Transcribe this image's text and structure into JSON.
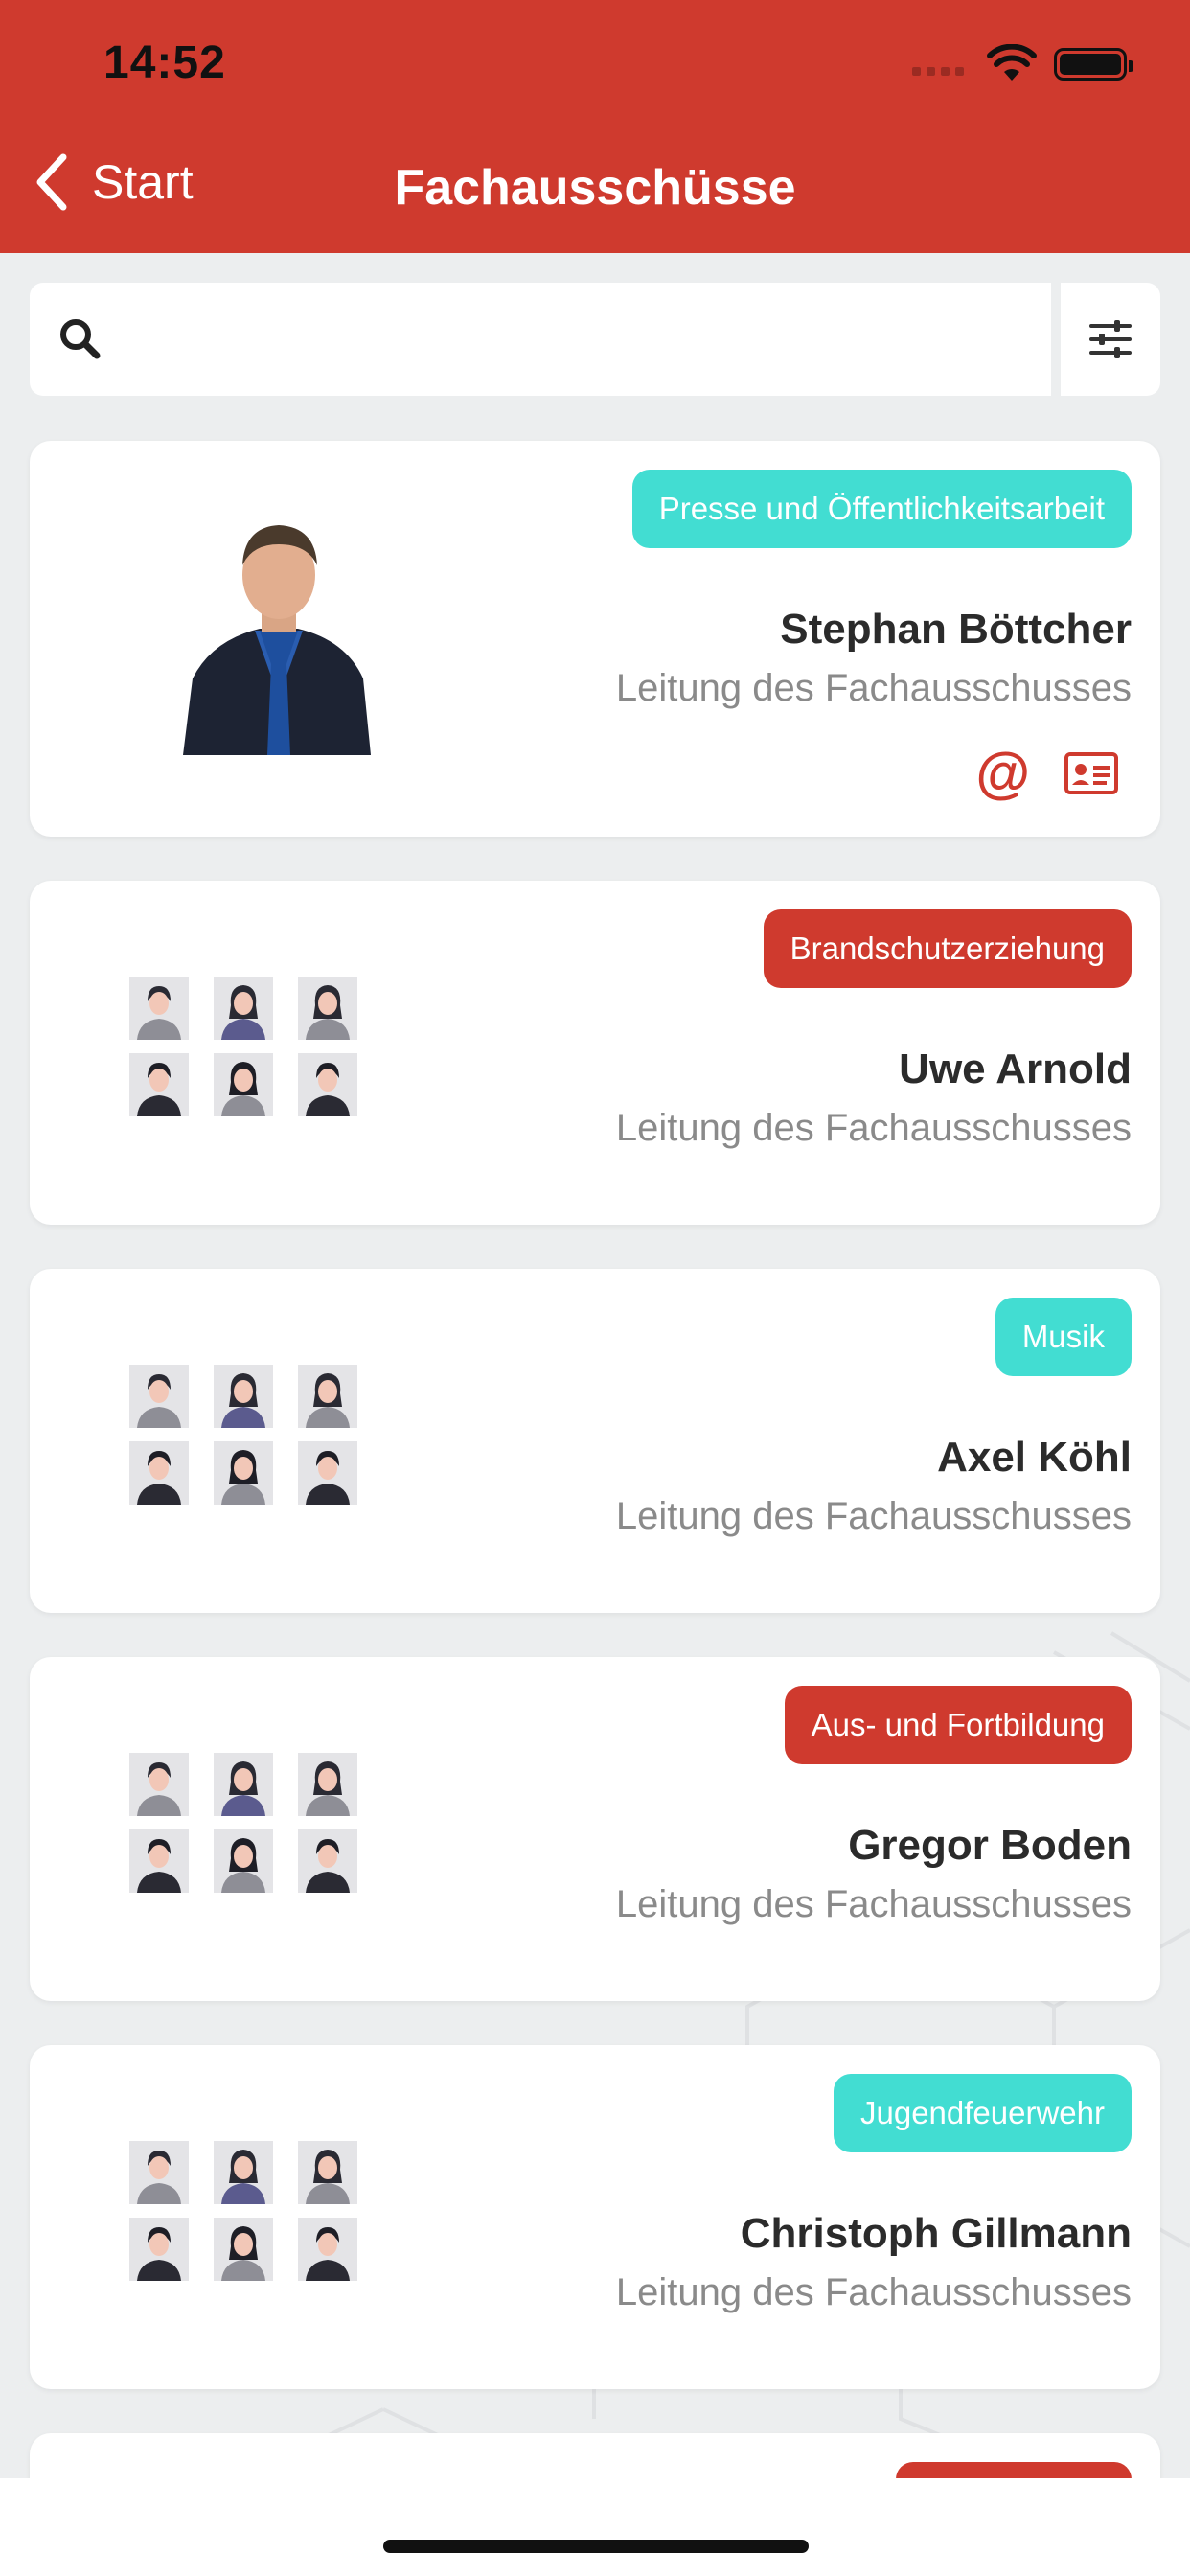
{
  "status_bar": {
    "time": "14:52"
  },
  "nav": {
    "back_label": "Start",
    "title": "Fachausschüsse"
  },
  "search": {
    "placeholder": ""
  },
  "colors": {
    "accent_red": "#cf3a2e",
    "accent_teal": "#42ddd2"
  },
  "cards": [
    {
      "badge": "Presse und Öffentlichkeitsarbeit",
      "badge_color": "teal",
      "name": "Stephan Böttcher",
      "role": "Leitung des Fachausschusses",
      "has_photo": true,
      "contact_icons": [
        "email-icon",
        "vcard-icon"
      ]
    },
    {
      "badge": "Brandschutzerziehung",
      "badge_color": "red",
      "name": "Uwe Arnold",
      "role": "Leitung des Fachausschusses",
      "has_photo": false
    },
    {
      "badge": "Musik",
      "badge_color": "teal",
      "name": "Axel Köhl",
      "role": "Leitung des Fachausschusses",
      "has_photo": false
    },
    {
      "badge": "Aus- und Fortbildung",
      "badge_color": "red",
      "name": "Gregor Boden",
      "role": "Leitung des Fachausschusses",
      "has_photo": false
    },
    {
      "badge": "Jugendfeuerwehr",
      "badge_color": "teal",
      "name": "Christoph Gillmann",
      "role": "Leitung des Fachausschusses",
      "has_photo": false
    },
    {
      "badge": "",
      "badge_color": "red",
      "partial": true
    }
  ]
}
